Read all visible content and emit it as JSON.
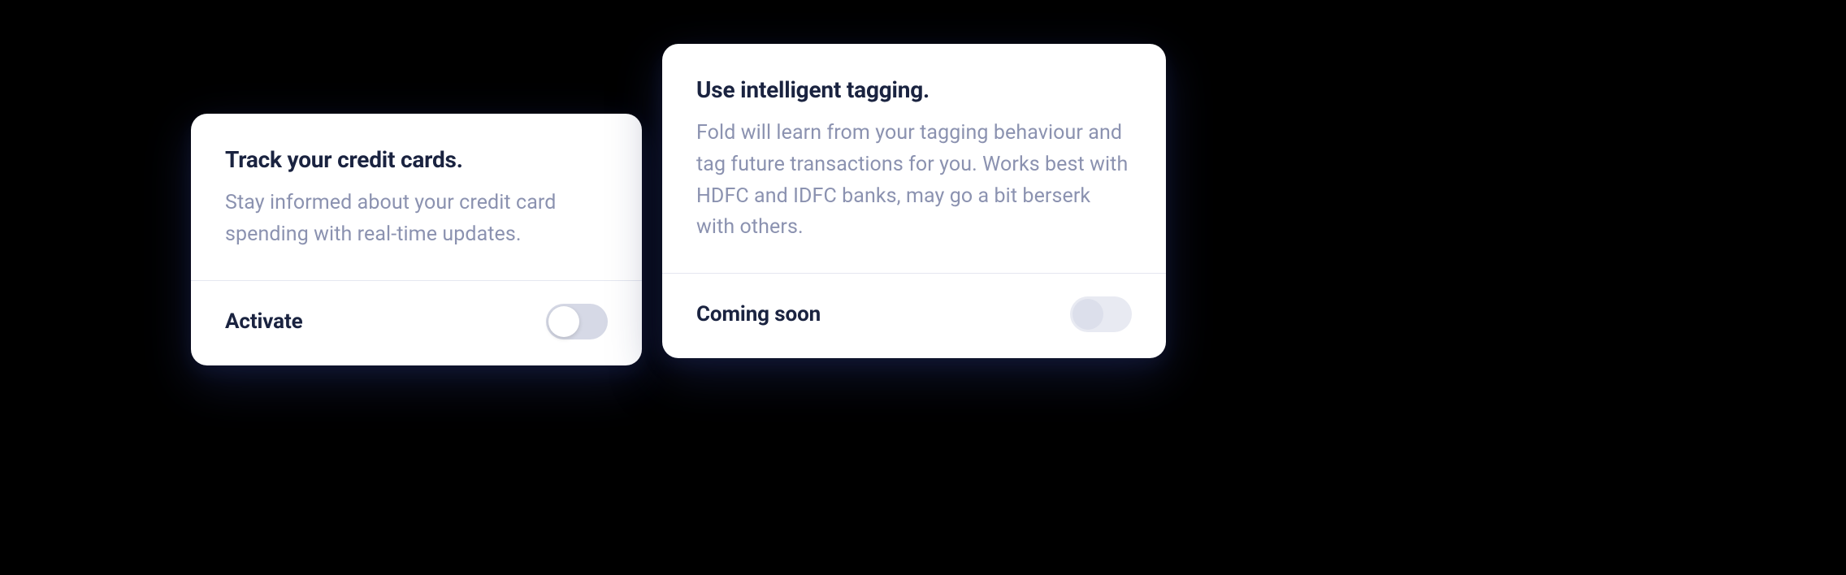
{
  "cards": [
    {
      "title": "Track your credit cards.",
      "description": "Stay informed about your credit card spending with real-time updates.",
      "footerLabel": "Activate"
    },
    {
      "title": "Use intelligent tagging.",
      "description": "Fold will learn from your tagging behaviour and tag future transactions for you. Works best with HDFC and IDFC banks, may go a bit berserk with others.",
      "footerLabel": "Coming soon"
    }
  ]
}
